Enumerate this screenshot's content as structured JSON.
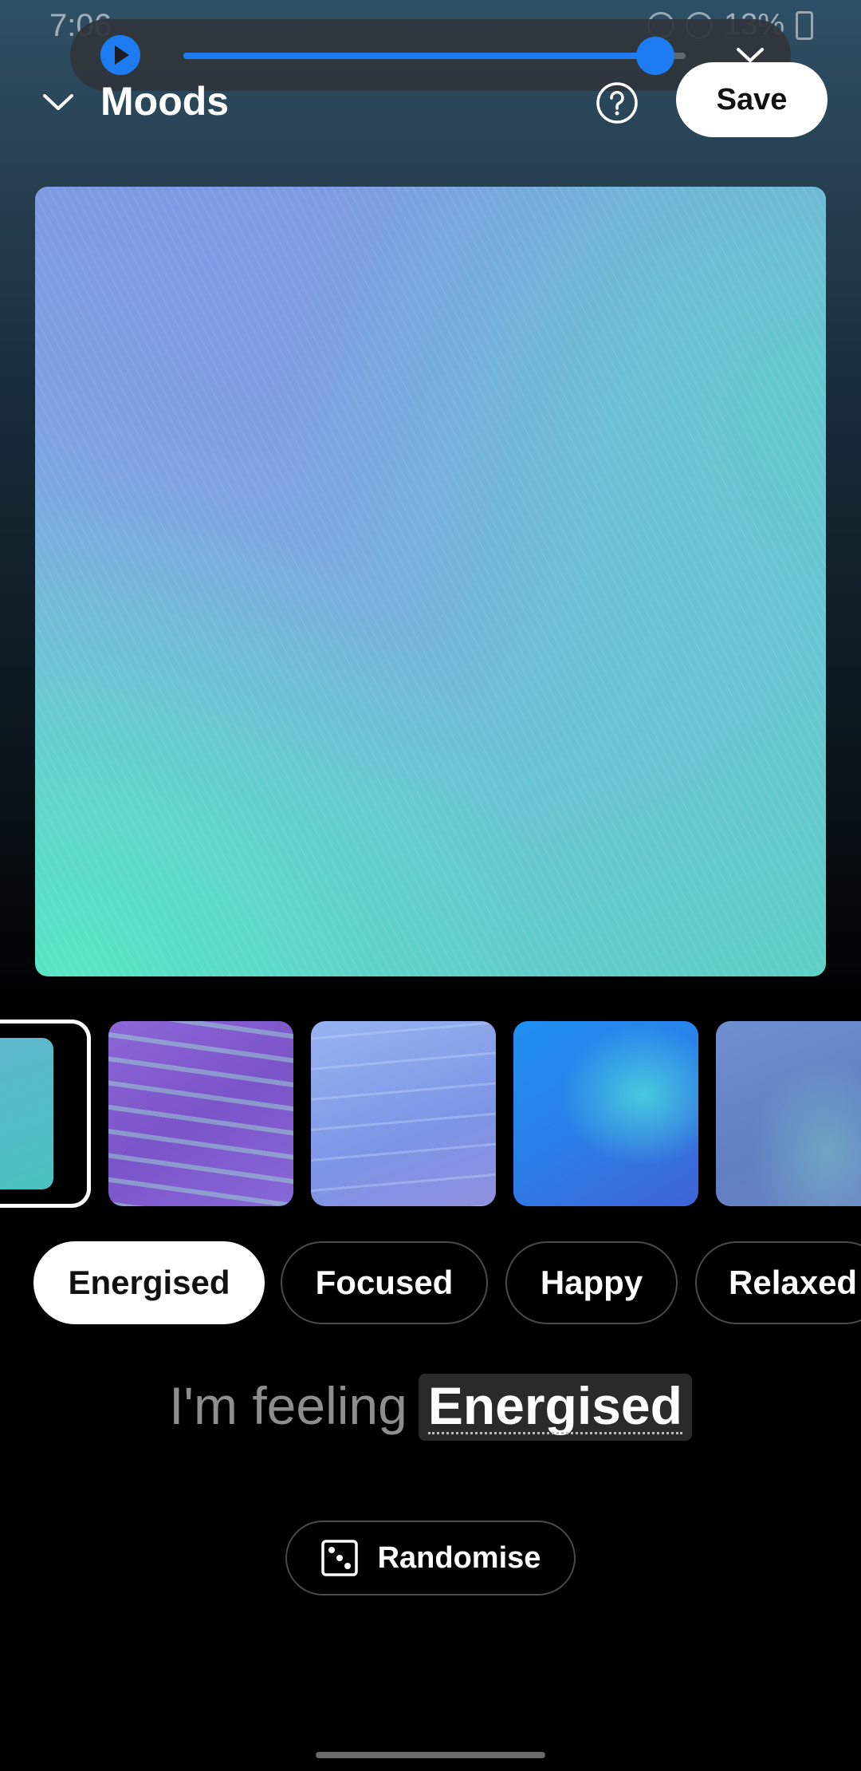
{
  "status_bar": {
    "time": "7:06",
    "battery_text": "13%"
  },
  "media_player": {
    "progress": 0.94
  },
  "header": {
    "title": "Moods",
    "save_label": "Save"
  },
  "thumbnails": [
    {
      "name": "wallpaper-1",
      "selected": true
    },
    {
      "name": "wallpaper-2",
      "selected": false
    },
    {
      "name": "wallpaper-3",
      "selected": false
    },
    {
      "name": "wallpaper-4",
      "selected": false
    },
    {
      "name": "wallpaper-5",
      "selected": false
    }
  ],
  "moods": [
    {
      "label": "Energised",
      "active": true
    },
    {
      "label": "Focused",
      "active": false
    },
    {
      "label": "Happy",
      "active": false
    },
    {
      "label": "Relaxed",
      "active": false
    }
  ],
  "feeling": {
    "prefix": "I'm feeling",
    "mood": "Energised"
  },
  "randomise_label": "Randomise",
  "colors": {
    "accent": "#1d7cf2",
    "chip_active_bg": "#ffffff",
    "background": "#000000"
  }
}
